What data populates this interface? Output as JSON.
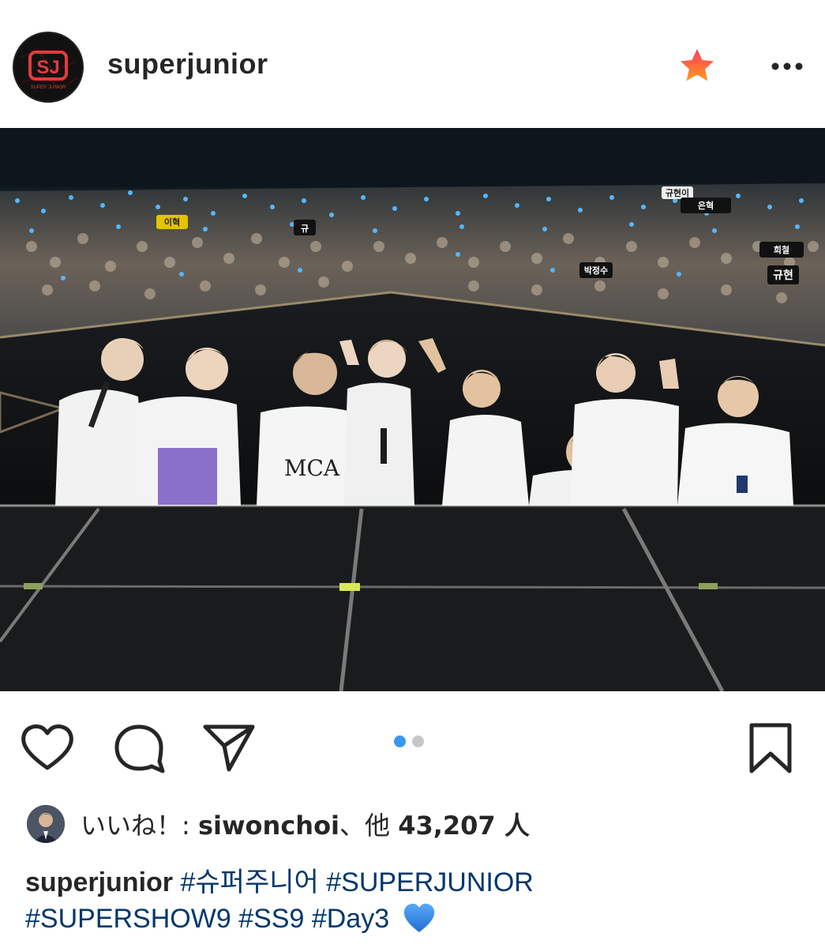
{
  "post": {
    "username": "superjunior",
    "avatar_text": "SJ",
    "avatar_subtext": "SUPER JUNIOR"
  },
  "photo": {
    "fan_signs": [
      "규현이",
      "은혁",
      "규",
      "이혁",
      "박정수",
      "규현",
      "희철"
    ],
    "shirt_text": "MCA"
  },
  "carousel": {
    "current": 1,
    "total": 2,
    "active_color": "#3897f0",
    "inactive_color": "#c7c7c7"
  },
  "likes": {
    "prefix": "いいね！: ",
    "user": "siwonchoi",
    "suffix": "、他 ",
    "count": "43,207",
    "unit": " 人"
  },
  "caption": {
    "user": "superjunior",
    "hashtags": [
      "#슈퍼주니어",
      "#SUPERJUNIOR",
      "#SUPERSHOW9",
      "#SS9",
      "#Day3"
    ],
    "emoji": "💙"
  },
  "colors": {
    "star": "#ff6a1f",
    "link": "#00376b",
    "text": "#262626"
  },
  "icons": [
    "heart-icon",
    "comment-icon",
    "share-icon",
    "bookmark-icon",
    "star-icon",
    "more-icon"
  ]
}
